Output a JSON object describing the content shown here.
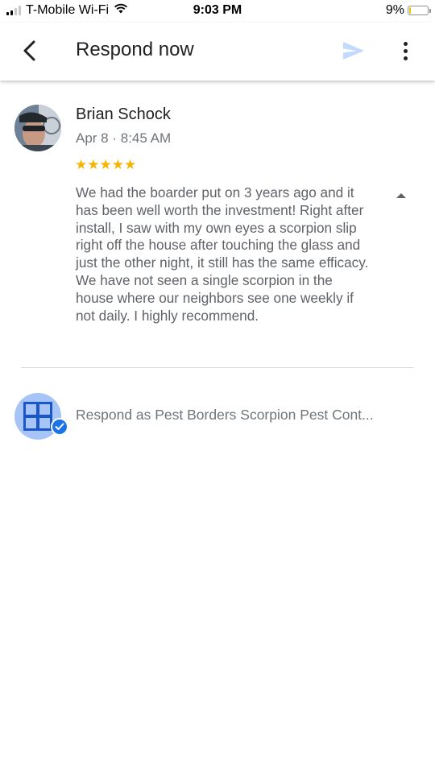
{
  "status_bar": {
    "carrier": "T-Mobile Wi-Fi",
    "time": "9:03 PM",
    "battery_percent": "9%",
    "battery_level": 0.09,
    "signal_bars": 2,
    "icons": [
      "cellular-signal-icon",
      "wifi-icon",
      "battery-icon"
    ]
  },
  "app_bar": {
    "title": "Respond now",
    "icons": [
      "back-arrow-icon",
      "send-icon",
      "more-vert-icon"
    ]
  },
  "review": {
    "reviewer_name": "Brian Schock",
    "date": "Apr 8 · 8:45 AM",
    "stars": "★★★★★",
    "rating": 5,
    "text": "We had the boarder put on 3 years ago and it has been well worth the investment! Right after install, I saw with my own eyes a scorpion slip right off the house after touching the glass and just the other night, it still has the same efficacy. We have not seen a single scorpion in the house where our neighbors see one weekly if not daily. I highly recommend.",
    "icons": [
      "collapse-arrow-icon"
    ]
  },
  "respond": {
    "placeholder": "Respond as Pest Borders Scorpion Pest Cont...",
    "icons": [
      "business-logo-icon",
      "verified-check-icon"
    ]
  },
  "colors": {
    "accent": "#1a73e8",
    "star": "#f4b400",
    "secondary_text": "#70757a",
    "business_avatar_bg": "#a6c4f5",
    "send_icon_disabled": "#c2dafc"
  }
}
